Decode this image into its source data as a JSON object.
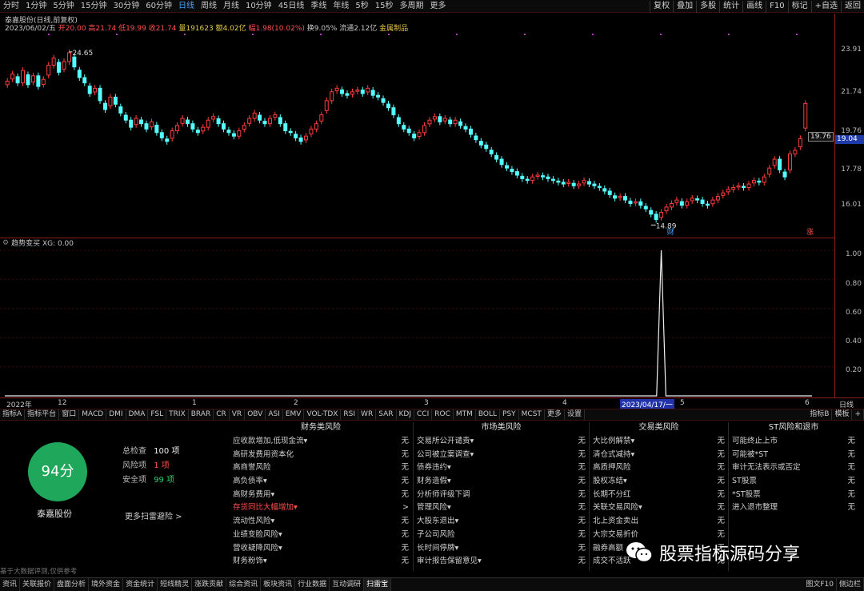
{
  "topbar": {
    "periods": [
      "分时",
      "1分钟",
      "5分钟",
      "15分钟",
      "30分钟",
      "60分钟",
      "日线",
      "周线",
      "月线",
      "10分钟",
      "45日线",
      "季线",
      "年线",
      "5秒",
      "15秒",
      "多周期",
      "更多"
    ],
    "active_period": "日线",
    "right_buttons": [
      "复权",
      "叠加",
      "多股",
      "统计",
      "画线",
      "F10",
      "标记",
      "+自选",
      "返回"
    ]
  },
  "info": {
    "title": "泰嘉股份(日线,前复权)",
    "date": "2023/06/02/五",
    "open": "开20.00",
    "high": "高21.74",
    "low": "低19.99",
    "close": "收21.74",
    "volume": "量191623",
    "amount": "额4.02亿",
    "change": "幅1.98(10.02%)",
    "turnover": "换9.05%",
    "float": "流通2.12亿",
    "sector": "金属制品"
  },
  "price_axis": {
    "ticks": [
      "23.91",
      "21.74",
      "19.76",
      "17.78",
      "16.01"
    ],
    "current_price": "19.04",
    "price_tag": "19.76"
  },
  "price_annotations": {
    "high_label": "24.65",
    "low_label": "14.89",
    "cai_label": "财",
    "zhang_label": "涨"
  },
  "subchart": {
    "header": "趋势变买 XG: 0.00",
    "ticks": [
      "1.00",
      "0.80",
      "0.60",
      "0.40",
      "0.20"
    ]
  },
  "xaxis": {
    "labels": [
      "2022年",
      "12",
      "1",
      "2",
      "3",
      "4",
      "2023/04/17/一",
      "5",
      "6"
    ],
    "right_label": "日线"
  },
  "indicator_tabs": {
    "items": [
      "指标A",
      "指标平台",
      "窗口",
      "MACD",
      "DMI",
      "DMA",
      "FSL",
      "TRIX",
      "BRAR",
      "CR",
      "VR",
      "OBV",
      "ASI",
      "EMV",
      "VOL-TDX",
      "RSI",
      "WR",
      "SAR",
      "KDJ",
      "CCI",
      "ROC",
      "MTM",
      "BOLL",
      "PSY",
      "MCST",
      "更多",
      "设置"
    ],
    "right": [
      "指标B",
      "模板",
      "+"
    ]
  },
  "scan": {
    "score": "94分",
    "stock_name": "泰嘉股份",
    "total_label": "总检查",
    "total_value": "100 项",
    "risk_label": "风险项",
    "risk_value": "1 项",
    "safe_label": "安全项",
    "safe_value": "99 项",
    "more_link": "更多扫雷避险 >",
    "disclaimer": "基于大数据评测,仅供参考"
  },
  "risk_columns": [
    {
      "header": "财务类风险",
      "items": [
        {
          "name": "应收款增加,低现金流▾",
          "value": "无"
        },
        {
          "name": "高研发费用资本化",
          "value": "无"
        },
        {
          "name": "高商誉风险",
          "value": "无"
        },
        {
          "name": "高负债率▾",
          "value": "无"
        },
        {
          "name": "高财务费用▾",
          "value": "无"
        },
        {
          "name": "存货同比大幅增加▾",
          "value": ">",
          "warn": true
        },
        {
          "name": "流动性风险▾",
          "value": "无"
        },
        {
          "name": "业绩变脸风险▾",
          "value": "无"
        },
        {
          "name": "营收疑降风险▾",
          "value": "无"
        },
        {
          "name": "财务粉饰▾",
          "value": "无"
        }
      ]
    },
    {
      "header": "市场类风险",
      "items": [
        {
          "name": "交易所公开谴责▾",
          "value": "无"
        },
        {
          "name": "公司被立案调查▾",
          "value": "无"
        },
        {
          "name": "债券违约▾",
          "value": "无"
        },
        {
          "name": "财务造假▾",
          "value": "无"
        },
        {
          "name": "分析师评级下调",
          "value": "无"
        },
        {
          "name": "管理风险▾",
          "value": "无"
        },
        {
          "name": "大股东退出▾",
          "value": "无"
        },
        {
          "name": "子公司风险",
          "value": "无"
        },
        {
          "name": "长时间停牌▾",
          "value": "无"
        },
        {
          "name": "审计报告保留意见▾",
          "value": "无"
        }
      ]
    },
    {
      "header": "交易类风险",
      "items": [
        {
          "name": "大比例解禁▾",
          "value": "无"
        },
        {
          "name": "清仓式减持▾",
          "value": "无"
        },
        {
          "name": "高质押风险",
          "value": "无"
        },
        {
          "name": "股权冻结▾",
          "value": "无"
        },
        {
          "name": "长期不分红",
          "value": "无"
        },
        {
          "name": "关联交易风险▾",
          "value": "无"
        },
        {
          "name": "北上资金卖出",
          "value": "无"
        },
        {
          "name": "大宗交易折价",
          "value": "无"
        },
        {
          "name": "融券高额",
          "value": "无"
        },
        {
          "name": "成交不活跃",
          "value": "无"
        }
      ]
    },
    {
      "header": "ST风险和退市",
      "items": [
        {
          "name": "可能终止上市",
          "value": "无"
        },
        {
          "name": "可能被*ST",
          "value": "无"
        },
        {
          "name": "审计无法表示或否定",
          "value": "无"
        },
        {
          "name": "ST股票",
          "value": "无"
        },
        {
          "name": "*ST股票",
          "value": "无"
        },
        {
          "name": "进入退市整理",
          "value": "无"
        }
      ]
    }
  ],
  "bottombar": {
    "items": [
      "资讯",
      "关联报价",
      "盘面分析",
      "境外资金",
      "资金统计",
      "短线精灵",
      "涨跌贡献",
      "综合资讯",
      "板块资讯",
      "行业数据",
      "互动调研",
      "扫雷宝"
    ],
    "right": [
      "图文F10",
      "侧边栏"
    ]
  },
  "watermark": {
    "text": "股票指标源码分享"
  },
  "chart_data": [
    {
      "type": "candlestick",
      "title": "泰嘉股份(日线,前复权)",
      "ylim": [
        14.5,
        25.5
      ],
      "yticks": [
        23.91,
        21.74,
        19.76,
        17.78,
        16.01
      ],
      "annotations": [
        {
          "label": "24.65",
          "kind": "high"
        },
        {
          "label": "14.89",
          "kind": "low"
        }
      ],
      "closes": [
        23.0,
        23.4,
        22.9,
        23.6,
        22.8,
        23.3,
        22.7,
        23.1,
        23.9,
        24.3,
        23.5,
        24.1,
        24.6,
        23.8,
        23.2,
        22.9,
        22.3,
        22.6,
        21.9,
        21.4,
        22.1,
        21.7,
        21.2,
        20.8,
        20.4,
        20.9,
        20.6,
        20.3,
        20.7,
        20.1,
        19.8,
        19.6,
        20.2,
        20.5,
        20.9,
        20.6,
        20.3,
        20.1,
        20.4,
        20.8,
        21.0,
        20.6,
        20.3,
        20.1,
        19.9,
        20.2,
        20.5,
        20.9,
        21.2,
        20.8,
        20.6,
        20.9,
        21.1,
        20.6,
        20.2,
        20.1,
        19.8,
        19.6,
        19.9,
        20.3,
        20.6,
        21.1,
        21.9,
        22.4,
        22.6,
        22.3,
        22.2,
        22.4,
        22.5,
        22.3,
        22.6,
        22.2,
        22.1,
        21.8,
        21.5,
        21.1,
        20.6,
        20.3,
        20.1,
        19.8,
        20.1,
        20.5,
        20.8,
        21.0,
        20.7,
        20.9,
        20.6,
        20.8,
        20.5,
        20.3,
        20.0,
        19.7,
        19.4,
        19.2,
        18.9,
        18.6,
        18.3,
        18.1,
        17.9,
        17.7,
        17.5,
        17.4,
        17.6,
        17.7,
        17.6,
        17.5,
        17.4,
        17.3,
        17.2,
        17.3,
        17.1,
        17.2,
        17.4,
        17.2,
        17.1,
        17.0,
        16.8,
        16.6,
        16.4,
        16.5,
        16.3,
        16.1,
        16.2,
        16.0,
        15.8,
        15.5,
        15.2,
        15.6,
        15.9,
        16.1,
        16.3,
        16.0,
        16.2,
        16.4,
        16.3,
        16.1,
        16.0,
        16.3,
        16.5,
        16.7,
        16.9,
        17.0,
        17.1,
        17.0,
        17.2,
        17.4,
        17.3,
        17.6,
        18.1,
        18.6,
        18.0,
        17.6,
        18.9,
        19.1,
        19.76,
        21.74
      ],
      "indicator": {
        "name": "趋势变买",
        "signal_index": 127,
        "signal_value": 1.0
      }
    }
  ]
}
